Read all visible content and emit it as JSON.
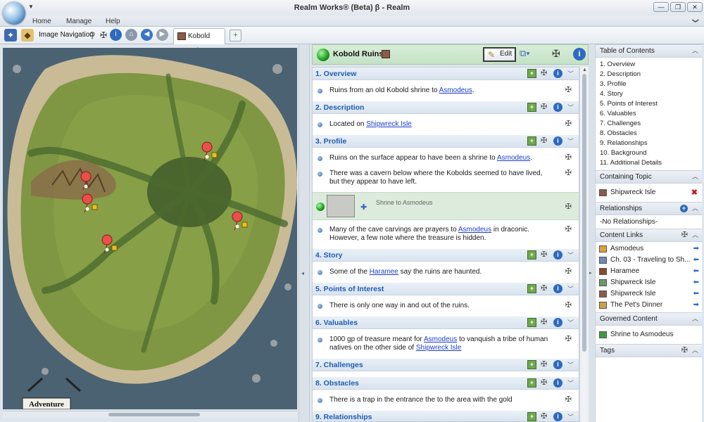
{
  "window": {
    "title": "Realm Works® (Beta) β - Realm",
    "qat_arrow": "▼",
    "controls": {
      "minimize": "—",
      "restore": "❐",
      "close": "✕"
    }
  },
  "ribbon": {
    "tabs": [
      "Home",
      "Manage",
      "Help"
    ],
    "collapse_arrow": "❯"
  },
  "toolbar": {
    "image_navigation_label": "Image Navigation",
    "doc_tab_label": "Kobold Ruins"
  },
  "colors": {
    "topic_header": "#c4e2c6",
    "section_title": "#1e5cb3",
    "link": "#1c3ec8",
    "map_water": "#4a6272",
    "map_land": "#7f9642"
  },
  "map": {
    "pin_count": 5,
    "logo_text": "Adventure"
  },
  "topic": {
    "title": "Kobold Ruins",
    "edit_label": "Edit",
    "sections": [
      {
        "title": "1. Overview",
        "snippets": [
          {
            "before": "Ruins from an old Kobold shrine to ",
            "link": "Asmodeus",
            "after": "."
          }
        ]
      },
      {
        "title": "2. Description",
        "snippets": [
          {
            "before": "Located on ",
            "link": "Shipwreck Isle",
            "after": ""
          }
        ]
      },
      {
        "title": "3. Profile",
        "snippets": [
          {
            "before": "Ruins on the surface appear to have been a shrine to ",
            "link": "Asmodeus",
            "after": "."
          },
          {
            "before": "There was a cavern below where the Kobolds seemed to have lived, but they appear to have left.",
            "link": "",
            "after": ""
          }
        ],
        "map_snippet": {
          "caption": "Shrine to Asmodeus"
        },
        "snippets_after": [
          {
            "before": "Many of the cave carvings are prayers to ",
            "link": "Asmodeus",
            "after": " in draconic. However, a few note where the treasure is hidden."
          }
        ]
      },
      {
        "title": "4. Story",
        "snippets": [
          {
            "before": "Some of the ",
            "link": "Haramee",
            "after": " say the ruins are haunted."
          }
        ]
      },
      {
        "title": "5. Points of Interest",
        "snippets": [
          {
            "before": "There is only one way in and out of the ruins.",
            "link": "",
            "after": ""
          }
        ]
      },
      {
        "title": "6. Valuables",
        "snippets": [
          {
            "before": "1000 gp of treasure meant for ",
            "link": "Asmodeus",
            "after": " to vanquish a tribe of human natives on the other side of ",
            "link2": "Shipwreck Isle"
          }
        ]
      },
      {
        "title": "7. Challenges",
        "snippets": []
      },
      {
        "title": "8. Obstacles",
        "snippets": [
          {
            "before": "There is a trap in the entrance the to the area with the gold",
            "link": "",
            "after": ""
          }
        ]
      },
      {
        "title": "9. Relationships",
        "snippets": []
      }
    ]
  },
  "right_panel": {
    "toc": {
      "title": "Table of Contents",
      "items": [
        "1. Overview",
        "2. Description",
        "3. Profile",
        "4. Story",
        "5. Points of Interest",
        "6. Valuables",
        "7. Challenges",
        "8. Obstacles",
        "9. Relationships",
        "10. Background",
        "11. Additional Details"
      ]
    },
    "containing_topic": {
      "title": "Containing Topic",
      "item": "Shipwreck Isle"
    },
    "relationships": {
      "title": "Relationships",
      "empty_text": "-No Relationships-"
    },
    "content_links": {
      "title": "Content Links",
      "items": [
        {
          "label": "Asmodeus",
          "icon": "scroll-icon",
          "color": "#d9a441"
        },
        {
          "label": "Ch. 03 - Traveling to Sh...",
          "icon": "link-icon",
          "color": "#6b8bb8"
        },
        {
          "label": "Haramee",
          "icon": "person-icon",
          "color": "#8a4a2a"
        },
        {
          "label": "Shipwreck Isle",
          "icon": "island-icon",
          "color": "#6a9a6a"
        },
        {
          "label": "Shipwreck Isle",
          "icon": "island-icon",
          "color": "#8a5a4a"
        },
        {
          "label": "The Pet's Dinner",
          "icon": "door-icon",
          "color": "#c9a24a"
        }
      ]
    },
    "governed_content": {
      "title": "Governed Content",
      "item": "Shrine to Asmodeus"
    },
    "tags": {
      "title": "Tags"
    }
  }
}
